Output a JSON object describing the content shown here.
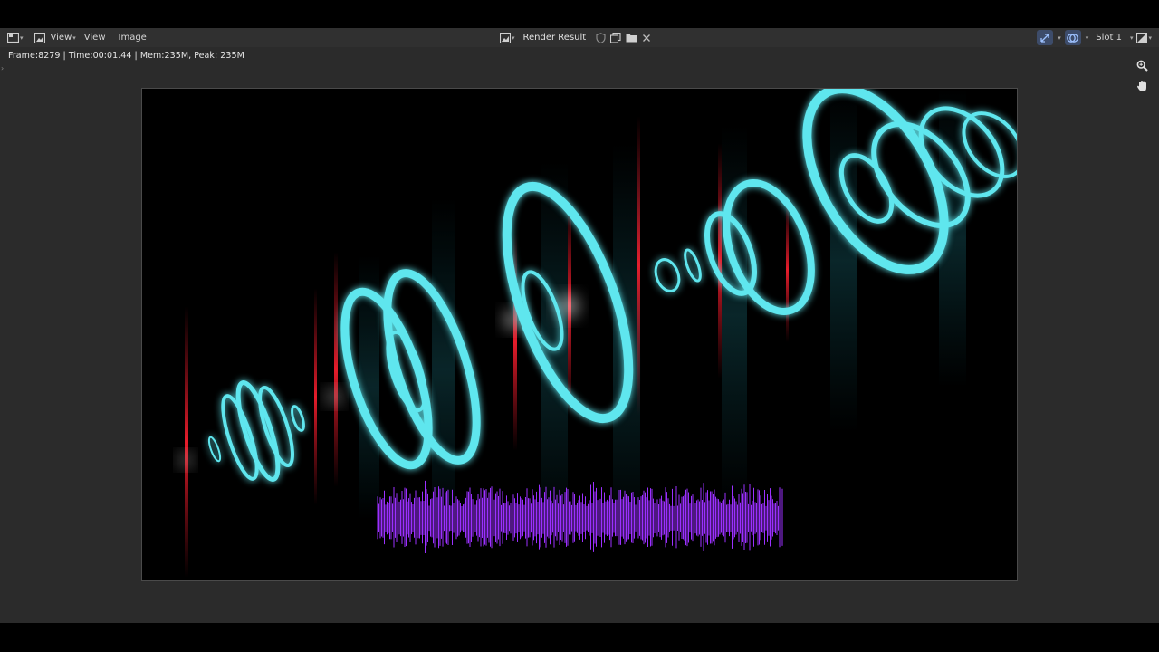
{
  "header": {
    "editor_type_icon": "image-editor-icon",
    "mode_icon": "view-mode-icon",
    "mode_label": "View",
    "menus": [
      "View",
      "Image"
    ],
    "image_browse_icon": "image-browse-icon",
    "image_name": "Render Result",
    "fake_user_icon": "shield-icon",
    "new_image_icon": "new-image-icon",
    "open_image_icon": "folder-icon",
    "unlink_icon": "close-icon",
    "right": {
      "gizmo_icon": "gizmo-icon",
      "overlay_icon": "overlay-icon",
      "slot_label": "Slot 1",
      "display_channels_icon": "display-channels-icon"
    }
  },
  "status": {
    "text": "Frame:8279 | Time:00:01.44 | Mem:235M, Peak: 235M"
  },
  "navigation": {
    "zoom_icon": "zoom-icon",
    "pan_icon": "hand-icon"
  },
  "render": {
    "ring_color": "#5fe6ee",
    "flare_color": "#d01020",
    "waveform_color": "#9b30ff",
    "background": "#000000"
  },
  "colors": {
    "editor_bg": "#2b2b2b",
    "header_bg": "#303030",
    "active_tool_bg": "#3d4c6a",
    "accent_blue": "#4a90e2"
  }
}
